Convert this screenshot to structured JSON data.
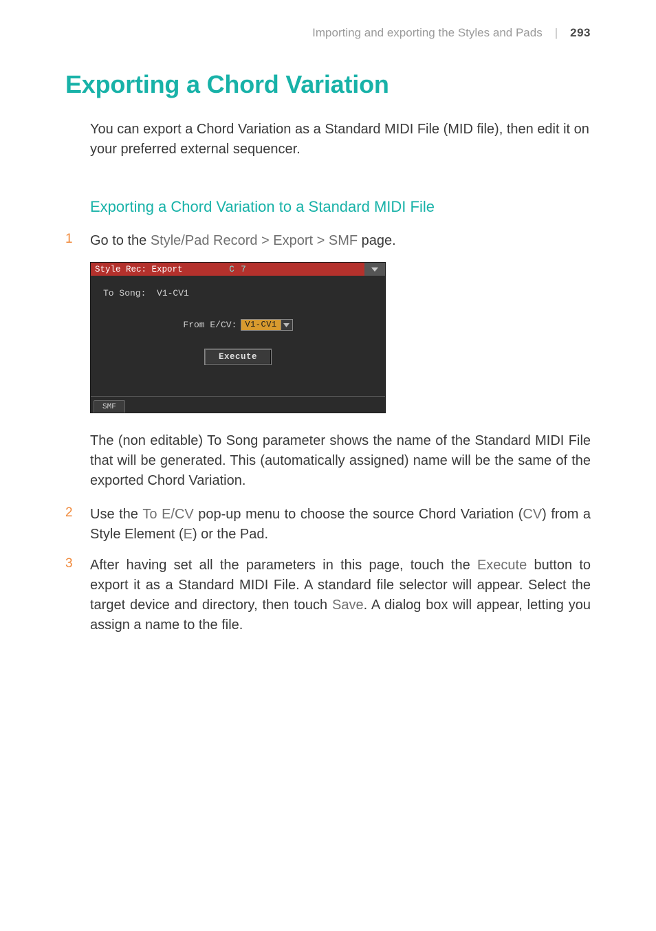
{
  "header": {
    "section": "Importing and exporting the Styles and Pads",
    "page_number": "293"
  },
  "h1": "Exporting a Chord Variation",
  "intro": "You can export a Chord Variation as a Standard MIDI File (MID file), then edit it on your preferred external sequencer.",
  "h2": "Exporting a Chord Variation to a Standard MIDI File",
  "steps": {
    "one": {
      "num": "1",
      "pre": "Go to the ",
      "bold": "Style/Pad Record > Export > SMF",
      "post": " page."
    },
    "two_pre_num": "2",
    "two_parts": {
      "a": "Use the ",
      "b": "To E/CV",
      "c": " pop-up menu to choose the source Chord Variation (",
      "d": "CV",
      "e": ") from a Style Element (",
      "f": "E",
      "g": ") or the Pad."
    },
    "three_num": "3",
    "three_parts": {
      "a": "After having set all the parameters in this page, touch the ",
      "b": "Execute",
      "c": " button to export it as a Standard MIDI File. A standard file selector will appear. Select the target device and directory, then touch ",
      "d": "Save",
      "e": ". A dialog box will appear, letting you assign a name to the file."
    }
  },
  "after_device": {
    "a": "The (non editable) ",
    "b": "To Song",
    "c": " parameter shows the name of the Standard MIDI File that will be generated. This (automatically assigned) name will be the same of the exported Chord Variation."
  },
  "device": {
    "title_left": "Style Rec: Export",
    "title_center": "C 7",
    "to_song_label": "To Song:  ",
    "to_song_value": "V1-CV1",
    "from_label": "From E/CV:",
    "from_value": "V1-CV1",
    "execute": "Execute",
    "tab": "SMF"
  }
}
